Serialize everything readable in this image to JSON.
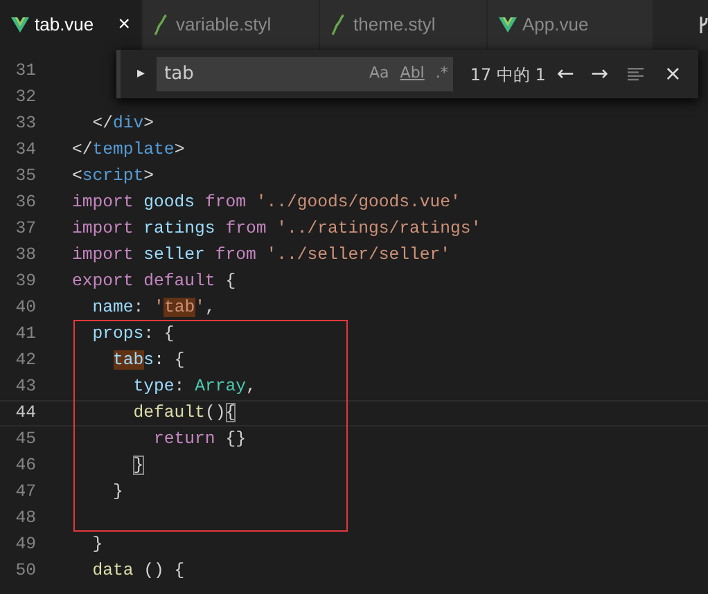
{
  "tabs": [
    {
      "label": "tab.vue",
      "kind": "vue",
      "selected": true,
      "close": "×"
    },
    {
      "label": "variable.styl",
      "kind": "stylus",
      "selected": false
    },
    {
      "label": "theme.styl",
      "kind": "stylus",
      "selected": false
    },
    {
      "label": "App.vue",
      "kind": "vue",
      "selected": false
    }
  ],
  "find_widget": {
    "toggle": "▸",
    "value": "tab",
    "options": [
      {
        "label": "Aa",
        "kind": "case"
      },
      {
        "label": "Abl",
        "kind": "word"
      },
      {
        "label": ".*",
        "kind": "regex"
      }
    ],
    "result": "17 中的 1",
    "prev": "←",
    "next": "→",
    "close": "×"
  },
  "code_blocks": [
    {
      "boxed": false,
      "lines": [
        {
          "number": "31",
          "current": false
        },
        {
          "number": "32",
          "current": false
        },
        {
          "number": "33",
          "current": false,
          "tokens": [
            {
              "text": "  </",
              "kind": "punct"
            },
            {
              "text": "div",
              "kind": "tag"
            },
            {
              "text": ">",
              "kind": "punct"
            }
          ]
        },
        {
          "number": "34",
          "current": false,
          "tokens": [
            {
              "text": "</",
              "kind": "punct"
            },
            {
              "text": "template",
              "kind": "tag"
            },
            {
              "text": ">",
              "kind": "punct"
            }
          ]
        },
        {
          "number": "35",
          "current": false,
          "tokens": [
            {
              "text": "<",
              "kind": "punct"
            },
            {
              "text": "script",
              "kind": "tag"
            },
            {
              "text": ">",
              "kind": "punct"
            }
          ]
        },
        {
          "number": "36",
          "current": false,
          "tokens": [
            {
              "text": "import ",
              "kind": "keyword"
            },
            {
              "text": "goods ",
              "kind": "variable"
            },
            {
              "text": "from ",
              "kind": "keyword"
            },
            {
              "text": "'../goods/goods.vue'",
              "kind": "string"
            }
          ]
        },
        {
          "number": "37",
          "current": false,
          "tokens": [
            {
              "text": "import ",
              "kind": "keyword"
            },
            {
              "text": "ratings ",
              "kind": "variable"
            },
            {
              "text": "from ",
              "kind": "keyword"
            },
            {
              "text": "'../ratings/ratings'",
              "kind": "string"
            }
          ]
        },
        {
          "number": "38",
          "current": false,
          "tokens": [
            {
              "text": "import ",
              "kind": "keyword"
            },
            {
              "text": "seller ",
              "kind": "variable"
            },
            {
              "text": "from ",
              "kind": "keyword"
            },
            {
              "text": "'../seller/seller'",
              "kind": "string"
            }
          ]
        },
        {
          "number": "39",
          "current": false,
          "tokens": [
            {
              "text": "export default ",
              "kind": "keyword"
            },
            {
              "text": "{",
              "kind": "punct"
            }
          ]
        },
        {
          "number": "40",
          "current": false,
          "tokens": [
            {
              "text": "  name",
              "kind": "variable"
            },
            {
              "text": ": ",
              "kind": "punct"
            },
            {
              "text": "'",
              "kind": "string"
            },
            {
              "text": "tab",
              "kind": "string",
              "find_match": true
            },
            {
              "text": "'",
              "kind": "string"
            },
            {
              "text": ",",
              "kind": "punct"
            }
          ]
        }
      ]
    },
    {
      "boxed": true,
      "lines": [
        {
          "number": "41",
          "current": false,
          "tokens": [
            {
              "text": "  props",
              "kind": "variable"
            },
            {
              "text": ": {",
              "kind": "punct"
            }
          ]
        },
        {
          "number": "42",
          "current": false,
          "tokens": [
            {
              "text": "    tab",
              "kind": "variable",
              "find_match": true
            },
            {
              "text": "s",
              "kind": "variable"
            },
            {
              "text": ": {",
              "kind": "punct"
            }
          ]
        },
        {
          "number": "43",
          "current": false,
          "tokens": [
            {
              "text": "      type",
              "kind": "variable"
            },
            {
              "text": ": ",
              "kind": "punct"
            },
            {
              "text": "Array",
              "kind": "type"
            },
            {
              "text": ",",
              "kind": "punct"
            }
          ]
        },
        {
          "number": "44",
          "current": true,
          "tokens": [
            {
              "text": "      default",
              "kind": "function"
            },
            {
              "text": "()",
              "kind": "punct"
            },
            {
              "text": "{",
              "kind": "punct",
              "bracket_match": true
            }
          ]
        },
        {
          "number": "45",
          "current": false,
          "tokens": [
            {
              "text": "        return ",
              "kind": "keyword"
            },
            {
              "text": "{}",
              "kind": "punct"
            }
          ]
        },
        {
          "number": "46",
          "current": false,
          "tokens": [
            {
              "text": "      }",
              "kind": "punct",
              "bracket_match": true
            }
          ]
        },
        {
          "number": "47",
          "current": false,
          "tokens": [
            {
              "text": "    }",
              "kind": "punct"
            }
          ]
        },
        {
          "number": "48",
          "current": false
        }
      ]
    },
    {
      "boxed": false,
      "lines": [
        {
          "number": "49",
          "current": false,
          "tokens": [
            {
              "text": "  }",
              "kind": "punct"
            }
          ]
        },
        {
          "number": "50",
          "current": false,
          "tokens": [
            {
              "text": "  data ",
              "kind": "function"
            },
            {
              "text": "() {",
              "kind": "punct"
            }
          ]
        }
      ]
    }
  ]
}
